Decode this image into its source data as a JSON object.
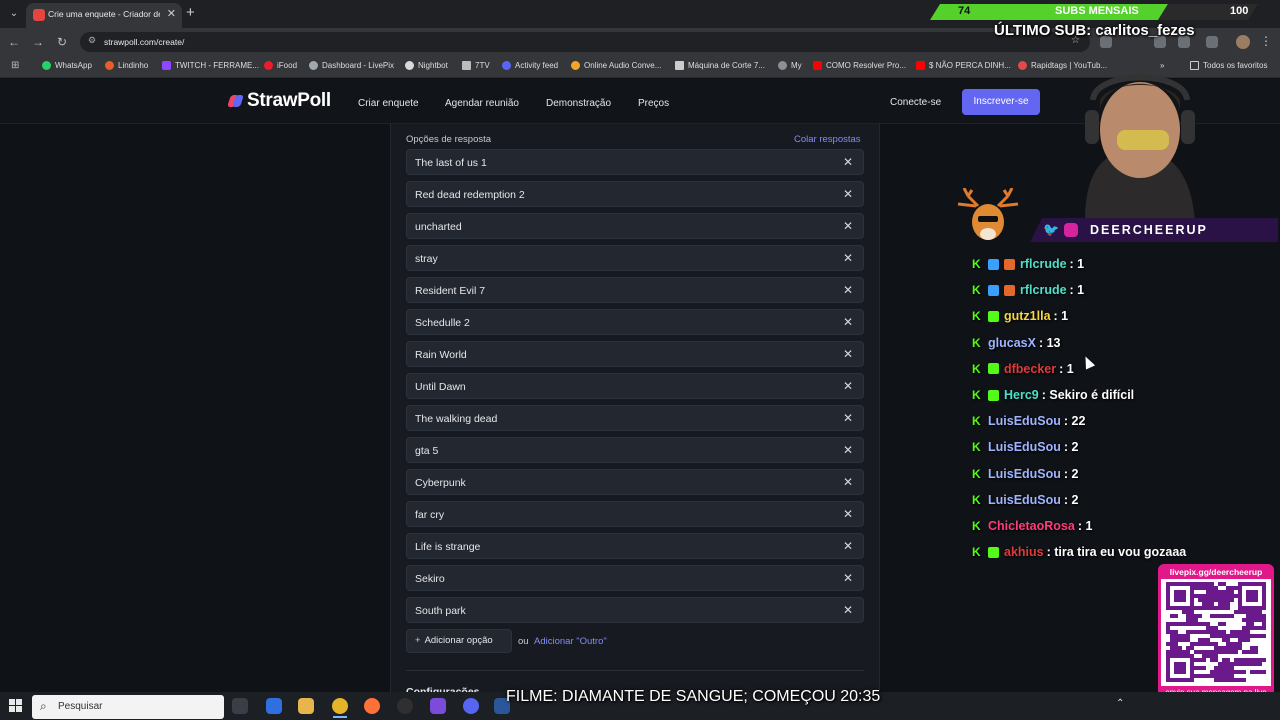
{
  "browser": {
    "tab_title": "Crie uma enquete - Criador de",
    "url": "strawpoll.com/create/",
    "bookmarks": [
      "WhatsApp",
      "Lindinho",
      "TWITCH - FERRAME...",
      "iFood",
      "Dashboard - LivePix",
      "Nightbot",
      "7TV",
      "Activity feed",
      "Online Audio Conve...",
      "Máquina de Corte 7...",
      "My",
      "COMO Resolver Pro...",
      "$ NÃO PERCA DINH...",
      "Rapidtags | YouTub..."
    ],
    "all_bookmarks": "Todos os favoritos"
  },
  "header": {
    "brand": "StrawPoll",
    "nav": [
      "Criar enquete",
      "Agendar reunião",
      "Demonstração",
      "Preços"
    ],
    "login": "Conecte-se",
    "signup": "Inscrever-se"
  },
  "form": {
    "options_label": "Opções de resposta",
    "paste_answers": "Colar respostas",
    "options": [
      "The last of us 1",
      "Red dead redemption 2",
      "uncharted",
      "stray",
      "Resident Evil 7",
      "Schedulle 2",
      "Rain World",
      "Until Dawn",
      "The walking dead",
      "gta 5",
      "Cyberpunk",
      "far cry",
      "Life is strange",
      "Sekiro",
      "South park"
    ],
    "add_option": "Adicionar opção",
    "or": "ou",
    "add_other": "Adicionar \"Outro\"",
    "settings_title": "Configurações"
  },
  "overlay": {
    "subs_count": "74",
    "subs_label": "SUBS MENSAIS",
    "subs_goal": "100",
    "subs_progress": 0.74,
    "last_sub": "ÚLTIMO SUB: carlitos_fezes",
    "channel": "DEERCHEERUP",
    "chat": [
      {
        "user": "rflcrude",
        "msg": ": 1",
        "color": "#4ee0c8"
      },
      {
        "user": "rflcrude",
        "msg": ": 1",
        "color": "#4ee0c8"
      },
      {
        "user": "gutz1lla",
        "msg": ": 1",
        "color": "#f5d742"
      },
      {
        "user": "glucasX",
        "msg": ": 13",
        "color": "#9fb4ff"
      },
      {
        "user": "dfbecker",
        "msg": ": 1",
        "color": "#e03a3a"
      },
      {
        "user": "Herc9",
        "msg": ": Sekiro é difícil",
        "color": "#4ee0c8"
      },
      {
        "user": "LuisEduSou",
        "msg": ": 22",
        "color": "#9fb4ff"
      },
      {
        "user": "LuisEduSou",
        "msg": ": 2",
        "color": "#9fb4ff"
      },
      {
        "user": "LuisEduSou",
        "msg": ": 2",
        "color": "#9fb4ff"
      },
      {
        "user": "LuisEduSou",
        "msg": ": 2",
        "color": "#9fb4ff"
      },
      {
        "user": "ChicletaoRosa",
        "msg": ": 1",
        "color": "#ff3b7a"
      },
      {
        "user": "akhius",
        "msg": ": tira tira eu vou gozaaa",
        "color": "#e03a3a"
      }
    ],
    "qr_header": "livepix.gg/deercheerup",
    "qr_footer": "envie sua mensagem na live via pix!",
    "ticker": "FILME: DIAMANTE DE SANGUE; COMEÇOU 20:35"
  },
  "taskbar": {
    "search": "Pesquisar"
  }
}
